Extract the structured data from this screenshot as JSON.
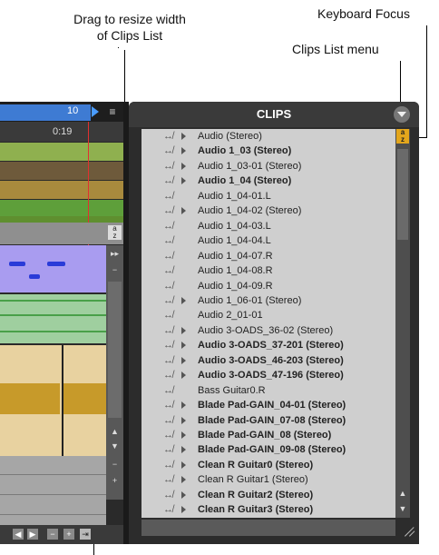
{
  "callouts": {
    "resize_width": "Drag to resize width\nof Clips List",
    "keyboard_focus": "Keyboard Focus",
    "clips_menu": "Clips List menu"
  },
  "edit_window": {
    "counter": "10",
    "timecode": "0:19",
    "ruler_menu_glyph": "≡",
    "az_label": "a\nz",
    "nav_buttons": [
      "◀",
      "▶",
      "−",
      "+",
      "⇥"
    ],
    "scroll_glyphs": {
      "up": "▲",
      "down": "▼",
      "minus": "−",
      "plus": "+",
      "arrows": "▸▸"
    },
    "track_colors": [
      "#8fb04f",
      "#6e5a3b",
      "#a88a3d",
      "#5e9f3a",
      "#5f8f2f"
    ]
  },
  "clips_panel": {
    "title": "CLIPS",
    "menu_icon": "chevron-down-icon",
    "focus_label": "a\nz",
    "scroll_up": "▲",
    "scroll_down": "▼",
    "connector_glyph": "↮",
    "clips": [
      {
        "name": "Audio (Stereo)",
        "bold": false,
        "expandable": true
      },
      {
        "name": "Audio 1_03 (Stereo)",
        "bold": true,
        "expandable": true
      },
      {
        "name": "Audio 1_03-01 (Stereo)",
        "bold": false,
        "expandable": true
      },
      {
        "name": "Audio 1_04 (Stereo)",
        "bold": true,
        "expandable": true
      },
      {
        "name": "Audio 1_04-01.L",
        "bold": false,
        "expandable": false
      },
      {
        "name": "Audio 1_04-02 (Stereo)",
        "bold": false,
        "expandable": true
      },
      {
        "name": "Audio 1_04-03.L",
        "bold": false,
        "expandable": false
      },
      {
        "name": "Audio 1_04-04.L",
        "bold": false,
        "expandable": false
      },
      {
        "name": "Audio 1_04-07.R",
        "bold": false,
        "expandable": false
      },
      {
        "name": "Audio 1_04-08.R",
        "bold": false,
        "expandable": false
      },
      {
        "name": "Audio 1_04-09.R",
        "bold": false,
        "expandable": false
      },
      {
        "name": "Audio 1_06-01 (Stereo)",
        "bold": false,
        "expandable": true
      },
      {
        "name": "Audio 2_01-01",
        "bold": false,
        "expandable": false
      },
      {
        "name": "Audio 3-OADS_36-02 (Stereo)",
        "bold": false,
        "expandable": true
      },
      {
        "name": "Audio 3-OADS_37-201 (Stereo)",
        "bold": true,
        "expandable": true
      },
      {
        "name": "Audio 3-OADS_46-203 (Stereo)",
        "bold": true,
        "expandable": true
      },
      {
        "name": "Audio 3-OADS_47-196 (Stereo)",
        "bold": true,
        "expandable": true
      },
      {
        "name": "Bass Guitar0.R",
        "bold": false,
        "expandable": false
      },
      {
        "name": "Blade Pad-GAIN_04-01 (Stereo)",
        "bold": true,
        "expandable": true
      },
      {
        "name": "Blade Pad-GAIN_07-08 (Stereo)",
        "bold": true,
        "expandable": true
      },
      {
        "name": "Blade Pad-GAIN_08 (Stereo)",
        "bold": true,
        "expandable": true
      },
      {
        "name": "Blade Pad-GAIN_09-08 (Stereo)",
        "bold": true,
        "expandable": true
      },
      {
        "name": "Clean R Guitar0 (Stereo)",
        "bold": true,
        "expandable": true
      },
      {
        "name": "Clean R Guitar1 (Stereo)",
        "bold": false,
        "expandable": true
      },
      {
        "name": "Clean R Guitar2 (Stereo)",
        "bold": true,
        "expandable": true
      },
      {
        "name": "Clean R Guitar3 (Stereo)",
        "bold": true,
        "expandable": true
      }
    ]
  }
}
